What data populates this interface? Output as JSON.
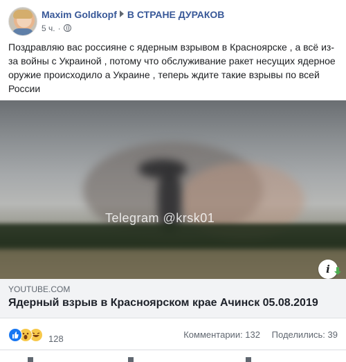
{
  "post": {
    "author": "Maxim Goldkopf",
    "group": "В СТРАНЕ ДУРАКОВ",
    "time": "5 ч.",
    "separator": "·",
    "text": "Поздравляю вас россияне с ядерным взрывом в Красноярске , а всё из-за войны с Украиной , потому что обслуживание ракет несущих ядерное оружие происходило а Украине , теперь ждите такие взрывы по всей России"
  },
  "video": {
    "watermark": "Telegram @krsk01"
  },
  "link": {
    "domain": "YOUTUBE.COM",
    "title": "Ядерный взрыв в Красноярском крае Ачинск 05.08.2019"
  },
  "stats": {
    "reactions_count": "128",
    "reaction_icons": [
      "like-icon",
      "wow-icon",
      "haha-icon"
    ],
    "comments": "Комментарии: 132",
    "shares": "Поделились: 39"
  },
  "colors": {
    "link_blue": "#385898",
    "like_blue": "#1877f2",
    "emoji_yellow": "#f7c84a",
    "secondary_text": "#606770"
  }
}
